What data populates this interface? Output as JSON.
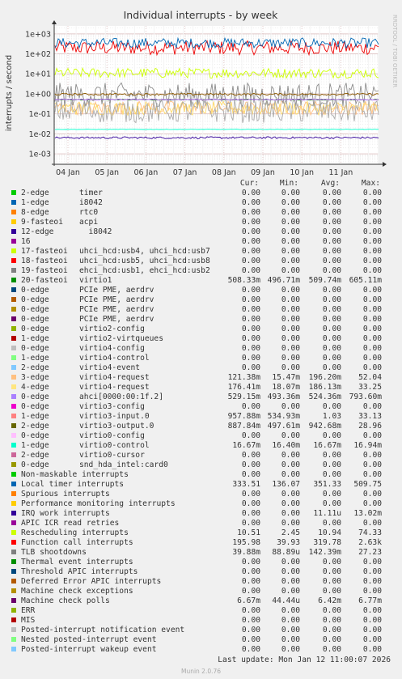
{
  "chart_data": {
    "type": "line",
    "title": "Individual interrupts - by week",
    "ylabel": "interrupts / second",
    "side_label": "RRDTOOL / TOBI OETIKER",
    "y_scale": "log",
    "ylim": [
      0.0003,
      2500
    ],
    "y_ticks": [
      "1e-03",
      "1e-02",
      "1e-01",
      "1e+00",
      "1e+01",
      "1e+02",
      "1e+03"
    ],
    "x_ticks": [
      "04 Jan",
      "05 Jan",
      "06 Jan",
      "07 Jan",
      "08 Jan",
      "09 Jan",
      "10 Jan",
      "11 Jan"
    ],
    "grid": true,
    "series_levels": [
      {
        "name": "Function call interrupts",
        "color": "#ee0000",
        "level": 200,
        "spread": 0.35
      },
      {
        "name": "20-fasteoi virtio1",
        "color": "#006600",
        "level": 0.509,
        "spread": 0.02
      },
      {
        "name": "Local timer interrupts",
        "color": "#0066b3",
        "level": 350,
        "spread": 0.25
      },
      {
        "name": "Rescheduling interrupts",
        "color": "#ccff00",
        "level": 11,
        "spread": 0.25
      },
      {
        "name": "Machine check polls",
        "color": "#330099",
        "level": 0.0064,
        "spread": 0.05
      },
      {
        "name": "3-edge virtio4-request",
        "color": "#ffbe80",
        "level": 0.2,
        "spread": 0.35
      },
      {
        "name": "4-edge virtio4-request",
        "color": "#ffd966",
        "level": 0.19,
        "spread": 0.35
      },
      {
        "name": "2-edge virtio3-output.0",
        "color": "#8c8c8c",
        "level": 0.9,
        "spread": 0.6
      },
      {
        "name": "1-edge virtio3-input.0",
        "color": "#8c5a00",
        "level": 0.95,
        "spread": 0.05
      },
      {
        "name": "0-edge ahci[0000:00:1f.2]",
        "color": "#b266ff",
        "level": 0.52,
        "spread": 0.03
      },
      {
        "name": "1-edge virtio0-control",
        "color": "#00ffcc",
        "level": 0.0167,
        "spread": 0.01
      },
      {
        "name": "TLB shootdowns",
        "color": "#aaaaaa",
        "level": 0.14,
        "spread": 0.6
      }
    ],
    "headers": {
      "cur": "Cur:",
      "min": "Min:",
      "avg": "Avg:",
      "max": "Max:"
    },
    "rows": [
      {
        "name": "2-edge",
        "desc": "timer",
        "color": "#00cc00",
        "cur": "0.00",
        "min": "0.00",
        "avg": "0.00",
        "max": "0.00"
      },
      {
        "name": "1-edge",
        "desc": "i8042",
        "color": "#0066b3",
        "cur": "0.00",
        "min": "0.00",
        "avg": "0.00",
        "max": "0.00"
      },
      {
        "name": "8-edge",
        "desc": "rtc0",
        "color": "#ff8000",
        "cur": "0.00",
        "min": "0.00",
        "avg": "0.00",
        "max": "0.00"
      },
      {
        "name": "9-fasteoi",
        "desc": "acpi",
        "color": "#ffcc00",
        "cur": "0.00",
        "min": "0.00",
        "avg": "0.00",
        "max": "0.00"
      },
      {
        "name": "12-edge",
        "desc": "  i8042",
        "color": "#330099",
        "cur": "0.00",
        "min": "0.00",
        "avg": "0.00",
        "max": "0.00"
      },
      {
        "name": "16",
        "desc": "",
        "color": "#990099",
        "cur": "0.00",
        "min": "0.00",
        "avg": "0.00",
        "max": "0.00"
      },
      {
        "name": "17-fasteoi",
        "desc": "uhci_hcd:usb4, uhci_hcd:usb7",
        "color": "#ccff00",
        "cur": "0.00",
        "min": "0.00",
        "avg": "0.00",
        "max": "0.00"
      },
      {
        "name": "18-fasteoi",
        "desc": "uhci_hcd:usb5, uhci_hcd:usb8",
        "color": "#ff0000",
        "cur": "0.00",
        "min": "0.00",
        "avg": "0.00",
        "max": "0.00"
      },
      {
        "name": "19-fasteoi",
        "desc": "ehci_hcd:usb1, ehci_hcd:usb2",
        "color": "#808080",
        "cur": "0.00",
        "min": "0.00",
        "avg": "0.00",
        "max": "0.00"
      },
      {
        "name": "20-fasteoi",
        "desc": "virtio1",
        "color": "#008f00",
        "cur": "508.33m",
        "min": "496.71m",
        "avg": "509.74m",
        "max": "605.11m"
      },
      {
        "name": "0-edge",
        "desc": "PCIe PME, aerdrv",
        "color": "#00487d",
        "cur": "0.00",
        "min": "0.00",
        "avg": "0.00",
        "max": "0.00"
      },
      {
        "name": "0-edge",
        "desc": "PCIe PME, aerdrv",
        "color": "#b35a00",
        "cur": "0.00",
        "min": "0.00",
        "avg": "0.00",
        "max": "0.00"
      },
      {
        "name": "0-edge",
        "desc": "PCIe PME, aerdrv",
        "color": "#b38f00",
        "cur": "0.00",
        "min": "0.00",
        "avg": "0.00",
        "max": "0.00"
      },
      {
        "name": "0-edge",
        "desc": "PCIe PME, aerdrv",
        "color": "#6b006b",
        "cur": "0.00",
        "min": "0.00",
        "avg": "0.00",
        "max": "0.00"
      },
      {
        "name": "0-edge",
        "desc": "virtio2-config",
        "color": "#8fb300",
        "cur": "0.00",
        "min": "0.00",
        "avg": "0.00",
        "max": "0.00"
      },
      {
        "name": "1-edge",
        "desc": "virtio2-virtqueues",
        "color": "#b30000",
        "cur": "0.00",
        "min": "0.00",
        "avg": "0.00",
        "max": "0.00"
      },
      {
        "name": "0-edge",
        "desc": "virtio4-config",
        "color": "#bebebe",
        "cur": "0.00",
        "min": "0.00",
        "avg": "0.00",
        "max": "0.00"
      },
      {
        "name": "1-edge",
        "desc": "virtio4-control",
        "color": "#80ff80",
        "cur": "0.00",
        "min": "0.00",
        "avg": "0.00",
        "max": "0.00"
      },
      {
        "name": "2-edge",
        "desc": "virtio4-event",
        "color": "#80c9ff",
        "cur": "0.00",
        "min": "0.00",
        "avg": "0.00",
        "max": "0.00"
      },
      {
        "name": "3-edge",
        "desc": "virtio4-request",
        "color": "#ffc080",
        "cur": "121.38m",
        "min": "15.47m",
        "avg": "196.20m",
        "max": "52.04"
      },
      {
        "name": "4-edge",
        "desc": "virtio4-request",
        "color": "#ffe680",
        "cur": "176.41m",
        "min": "18.07m",
        "avg": "186.13m",
        "max": "33.25"
      },
      {
        "name": "0-edge",
        "desc": "ahci[0000:00:1f.2]",
        "color": "#aa80ff",
        "cur": "529.15m",
        "min": "493.36m",
        "avg": "524.36m",
        "max": "793.60m"
      },
      {
        "name": "0-edge",
        "desc": "virtio3-config",
        "color": "#ee00cc",
        "cur": "0.00",
        "min": "0.00",
        "avg": "0.00",
        "max": "0.00"
      },
      {
        "name": "1-edge",
        "desc": "virtio3-input.0",
        "color": "#ff8080",
        "cur": "957.88m",
        "min": "534.93m",
        "avg": "1.03",
        "max": "33.13"
      },
      {
        "name": "2-edge",
        "desc": "virtio3-output.0",
        "color": "#666600",
        "cur": "887.84m",
        "min": "497.61m",
        "avg": "942.68m",
        "max": "28.96"
      },
      {
        "name": "0-edge",
        "desc": "virtio0-config",
        "color": "#ffbfff",
        "cur": "0.00",
        "min": "0.00",
        "avg": "0.00",
        "max": "0.00"
      },
      {
        "name": "1-edge",
        "desc": "virtio0-control",
        "color": "#00ffcc",
        "cur": "16.67m",
        "min": "16.40m",
        "avg": "16.67m",
        "max": "16.94m"
      },
      {
        "name": "2-edge",
        "desc": "virtio0-cursor",
        "color": "#cc6699",
        "cur": "0.00",
        "min": "0.00",
        "avg": "0.00",
        "max": "0.00"
      },
      {
        "name": "0-edge",
        "desc": "snd_hda_intel:card0",
        "color": "#999900",
        "cur": "0.00",
        "min": "0.00",
        "avg": "0.00",
        "max": "0.00"
      },
      {
        "name": "Non-maskable interrupts",
        "desc": "",
        "color": "#00cc00",
        "cur": "0.00",
        "min": "0.00",
        "avg": "0.00",
        "max": "0.00"
      },
      {
        "name": "Local timer interrupts",
        "desc": "",
        "color": "#0066b3",
        "cur": "333.51",
        "min": "136.07",
        "avg": "351.33",
        "max": "509.75"
      },
      {
        "name": "Spurious interrupts",
        "desc": "",
        "color": "#ff8000",
        "cur": "0.00",
        "min": "0.00",
        "avg": "0.00",
        "max": "0.00"
      },
      {
        "name": "Performance monitoring interrupts",
        "desc": "",
        "color": "#ffcc00",
        "cur": "0.00",
        "min": "0.00",
        "avg": "0.00",
        "max": "0.00"
      },
      {
        "name": "IRQ work interrupts",
        "desc": "",
        "color": "#330099",
        "cur": "0.00",
        "min": "0.00",
        "avg": "11.11u",
        "max": "13.02m"
      },
      {
        "name": "APIC ICR read retries",
        "desc": "",
        "color": "#990099",
        "cur": "0.00",
        "min": "0.00",
        "avg": "0.00",
        "max": "0.00"
      },
      {
        "name": "Rescheduling interrupts",
        "desc": "",
        "color": "#ccff00",
        "cur": "10.51",
        "min": "2.45",
        "avg": "10.94",
        "max": "74.33"
      },
      {
        "name": "Function call interrupts",
        "desc": "",
        "color": "#ff0000",
        "cur": "195.98",
        "min": "39.93",
        "avg": "319.78",
        "max": "2.63k"
      },
      {
        "name": "TLB shootdowns",
        "desc": "",
        "color": "#808080",
        "cur": "39.88m",
        "min": "88.89u",
        "avg": "142.39m",
        "max": "27.23"
      },
      {
        "name": "Thermal event interrupts",
        "desc": "",
        "color": "#008f00",
        "cur": "0.00",
        "min": "0.00",
        "avg": "0.00",
        "max": "0.00"
      },
      {
        "name": "Threshold APIC interrupts",
        "desc": "",
        "color": "#00487d",
        "cur": "0.00",
        "min": "0.00",
        "avg": "0.00",
        "max": "0.00"
      },
      {
        "name": "Deferred Error APIC interrupts",
        "desc": "",
        "color": "#b35a00",
        "cur": "0.00",
        "min": "0.00",
        "avg": "0.00",
        "max": "0.00"
      },
      {
        "name": "Machine check exceptions",
        "desc": "",
        "color": "#b38f00",
        "cur": "0.00",
        "min": "0.00",
        "avg": "0.00",
        "max": "0.00"
      },
      {
        "name": "Machine check polls",
        "desc": "",
        "color": "#6b006b",
        "cur": "6.67m",
        "min": "44.44u",
        "avg": "6.42m",
        "max": "6.77m"
      },
      {
        "name": "ERR",
        "desc": "",
        "color": "#8fb300",
        "cur": "0.00",
        "min": "0.00",
        "avg": "0.00",
        "max": "0.00"
      },
      {
        "name": "MIS",
        "desc": "",
        "color": "#b30000",
        "cur": "0.00",
        "min": "0.00",
        "avg": "0.00",
        "max": "0.00"
      },
      {
        "name": "Posted-interrupt notification event",
        "desc": "",
        "color": "#bebebe",
        "cur": "0.00",
        "min": "0.00",
        "avg": "0.00",
        "max": "0.00"
      },
      {
        "name": "Nested posted-interrupt event",
        "desc": "",
        "color": "#80ff80",
        "cur": "0.00",
        "min": "0.00",
        "avg": "0.00",
        "max": "0.00"
      },
      {
        "name": "Posted-interrupt wakeup event",
        "desc": "",
        "color": "#80c9ff",
        "cur": "0.00",
        "min": "0.00",
        "avg": "0.00",
        "max": "0.00"
      }
    ]
  },
  "footer": {
    "last_update": "Last update: Mon Jan 12 11:00:07 2026",
    "version": "Munin 2.0.76"
  }
}
